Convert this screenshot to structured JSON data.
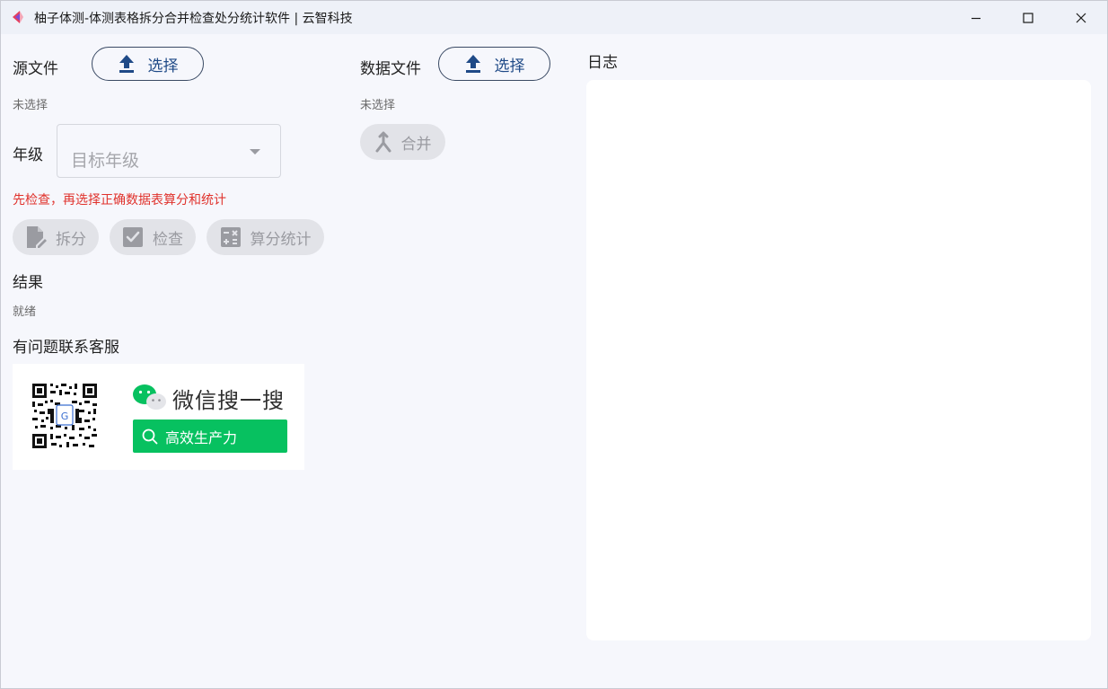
{
  "window": {
    "title": "柚子体测-体测表格拆分合并检查处分统计软件 | 云智科技",
    "minimize_glyph": "—",
    "maximize_glyph": "☐",
    "close_glyph": "✕"
  },
  "source": {
    "label": "源文件",
    "select_label": "选择",
    "status": "未选择"
  },
  "data_file": {
    "label": "数据文件",
    "select_label": "选择",
    "status": "未选择",
    "merge_label": "合并"
  },
  "grade": {
    "label": "年级",
    "placeholder": "目标年级"
  },
  "warning": "先检查，再选择正确数据表算分和统计",
  "actions": {
    "split_label": "拆分",
    "check_label": "检查",
    "stats_label": "算分统计"
  },
  "result": {
    "label": "结果",
    "status": "就绪"
  },
  "support": {
    "label": "有问题联系客服",
    "wechat_text": "微信搜一搜",
    "search_text": "高效生产力"
  },
  "log": {
    "label": "日志"
  },
  "colors": {
    "accent": "#1f4a87",
    "warning": "#e0322c",
    "wechat_green": "#07c160"
  },
  "icons": {
    "app": "app-logo-icon",
    "upload": "upload-icon",
    "merge": "merge-icon",
    "split": "edit-document-icon",
    "check": "checkbox-icon",
    "stats": "calculator-icon",
    "wechat": "wechat-icon",
    "search": "search-icon"
  }
}
